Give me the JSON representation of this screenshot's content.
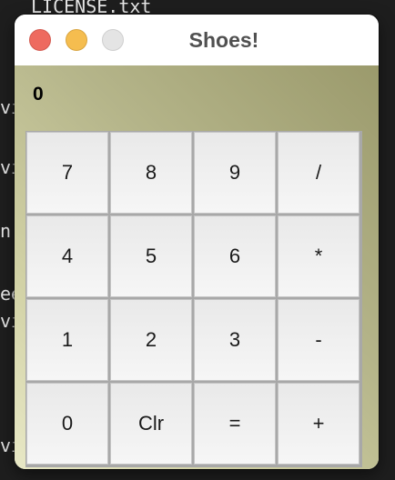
{
  "background_terminal": {
    "lines": [
      "LICENSE.txt",
      "vi",
      "vi",
      "n",
      "ee",
      "vi",
      "vi"
    ]
  },
  "window": {
    "title": "Shoes!",
    "traffic_lights": {
      "close_color": "#ee6a5f",
      "minimize_color": "#f5bd4f",
      "zoom_color": "#e4e4e4"
    }
  },
  "calculator": {
    "display_value": "0",
    "keys": [
      "7",
      "8",
      "9",
      "/",
      "4",
      "5",
      "6",
      "*",
      "1",
      "2",
      "3",
      "-",
      "0",
      "Clr",
      "=",
      "+"
    ]
  },
  "colors": {
    "content_gradient_start": "#9b9a6c",
    "content_gradient_end": "#e8e8c6",
    "key_background": "#f2f2f2",
    "key_text": "#1a1a1a"
  }
}
